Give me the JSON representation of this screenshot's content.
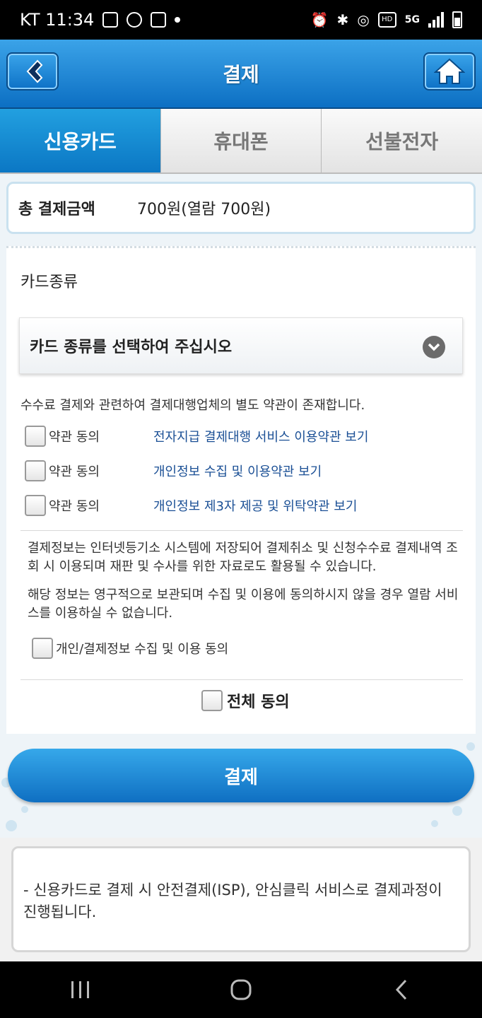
{
  "status_bar": {
    "carrier_time": "KT 11:34",
    "network": "5G"
  },
  "header": {
    "title": "결제"
  },
  "tabs": [
    {
      "label": "신용카드",
      "active": true
    },
    {
      "label": "휴대폰",
      "active": false
    },
    {
      "label": "선불전자",
      "active": false
    }
  ],
  "total": {
    "label": "총 결제금액",
    "value": "700원(열람 700원)"
  },
  "card": {
    "section_title": "카드종류",
    "select_placeholder": "카드 종류를 선택하여 주십시오"
  },
  "notice": "수수료 결제와 관련하여 결제대행업체의 별도 약관이 존재합니다.",
  "terms": [
    {
      "label": "약관 동의",
      "link": "전자지급 결제대행 서비스 이용약관 보기",
      "checked": false
    },
    {
      "label": "약관 동의",
      "link": "개인정보 수집 및 이용약관 보기",
      "checked": false
    },
    {
      "label": "약관 동의",
      "link": "개인정보 제3자 제공 및 위탁약관 보기",
      "checked": false
    }
  ],
  "info": {
    "p1": "결제정보는 인터넷등기소 시스템에 저장되어 결제취소 및 신청수수료 결제내역 조회 시 이용되며 재판 및 수사를 위한 자료로도 활용될 수 있습니다.",
    "p2": "해당 정보는 영구적으로 보관되며 수집 및 이용에 동의하시지 않을 경우 열람 서비스를 이용하실 수 없습니다.",
    "consent_label": "개인/결제정보 수집 및 이용 동의"
  },
  "all_agree_label": "전체 동의",
  "pay_button_label": "결제",
  "bottom_info": "- 신용카드로 결제 시 안전결제(ISP), 안심클릭 서비스로 결제과정이 진행됩니다.",
  "colors": {
    "primary": "#0c6fc3",
    "link": "#1a4f95"
  }
}
